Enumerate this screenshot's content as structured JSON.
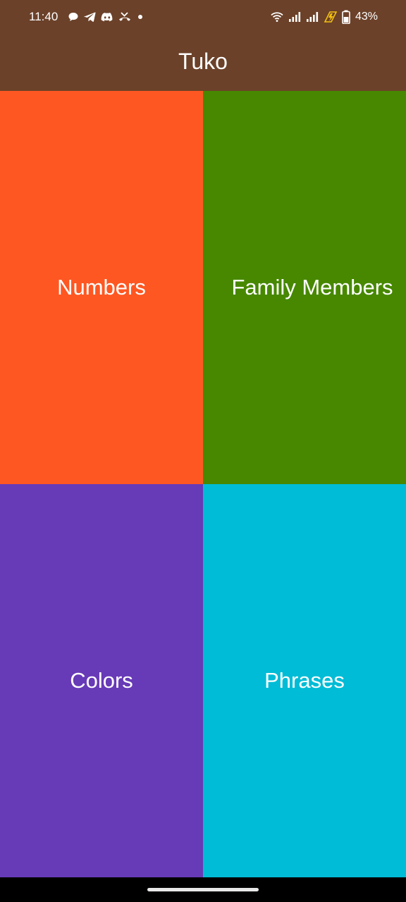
{
  "status_bar": {
    "time": "11:40",
    "battery_percent": "43%",
    "notification_icons": [
      "chat-bubble-icon",
      "telegram-icon",
      "discord-icon",
      "missed-call-icon",
      "dot-icon"
    ],
    "system_icons": [
      "wifi-icon",
      "signal-icon",
      "signal-icon",
      "charging-icon",
      "battery-icon"
    ]
  },
  "app_bar": {
    "title": "Tuko",
    "color": "#6b4129"
  },
  "tiles": [
    {
      "label": "Numbers",
      "color": "#ff5722"
    },
    {
      "label": "Family Members",
      "color": "#478800"
    },
    {
      "label": "Colors",
      "color": "#673ab7"
    },
    {
      "label": "Phrases",
      "color": "#00bcd6"
    }
  ]
}
